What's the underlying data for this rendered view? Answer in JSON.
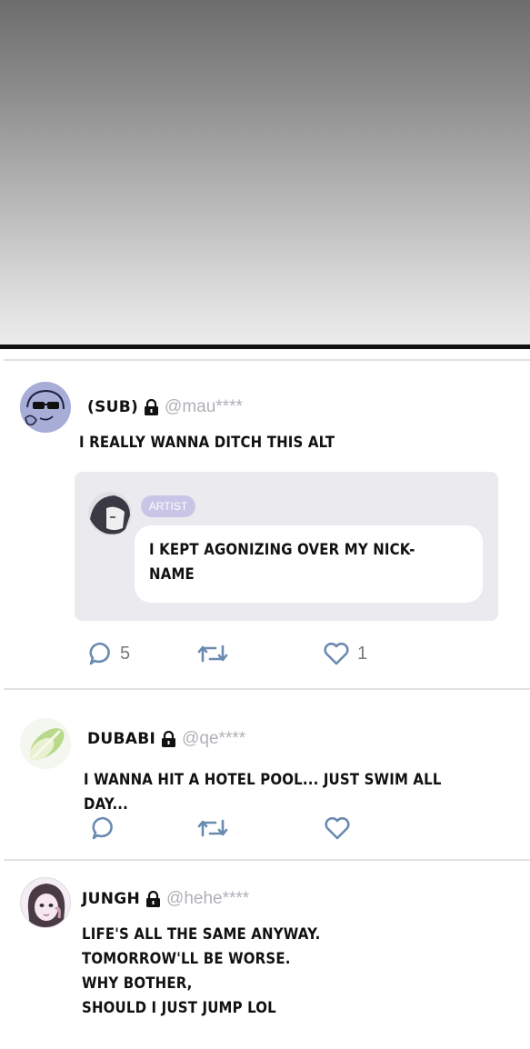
{
  "posts": [
    {
      "name": "(SUB)",
      "handle": "@mau****",
      "text": "I REALLY WANNA DITCH THIS ALT",
      "quote": {
        "badge": "ARTIST",
        "text": "I KEPT AGONIZING OVER MY NICK-\nNAME"
      },
      "replies": "5",
      "likes": "1"
    },
    {
      "name": "DUBABI",
      "handle": "@qe****",
      "text": "I WANNA HIT A HOTEL POOL... JUST SWIM ALL DAY..."
    },
    {
      "name": "JUNGH",
      "handle": "@hehe****",
      "text": "LIFE'S ALL THE SAME ANYWAY.\nTOMORROW'LL BE WORSE.\nWHY BOTHER,\nSHOULD I JUST JUMP LOL"
    }
  ],
  "colors": {
    "handle": "#b0b0b8",
    "icon": "#6a8ab0",
    "badge": "#c9c5e6",
    "quote_bg": "#ebebef"
  }
}
